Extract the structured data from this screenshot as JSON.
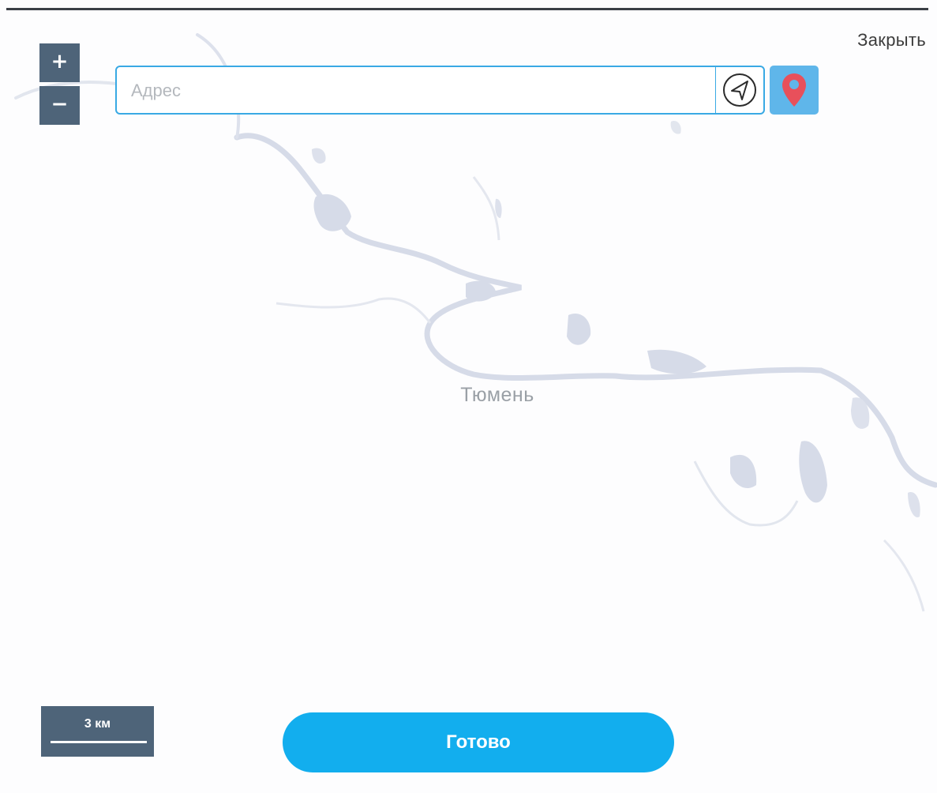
{
  "toolbar": {
    "close_label": "Закрыть",
    "zoom_in_label": "+",
    "zoom_out_label": "−"
  },
  "search": {
    "placeholder": "Адрес",
    "value": ""
  },
  "map": {
    "city_label": "Тюмень",
    "scale_label": "3 км",
    "water_color": "#d6dbe8",
    "background_color": "#fdfdfe"
  },
  "icons": {
    "locate": "navigation-arrow-icon",
    "pin": "map-pin-icon",
    "pin_color": "#e8505b",
    "accent": "#12aeee"
  },
  "footer": {
    "done_label": "Готово"
  }
}
